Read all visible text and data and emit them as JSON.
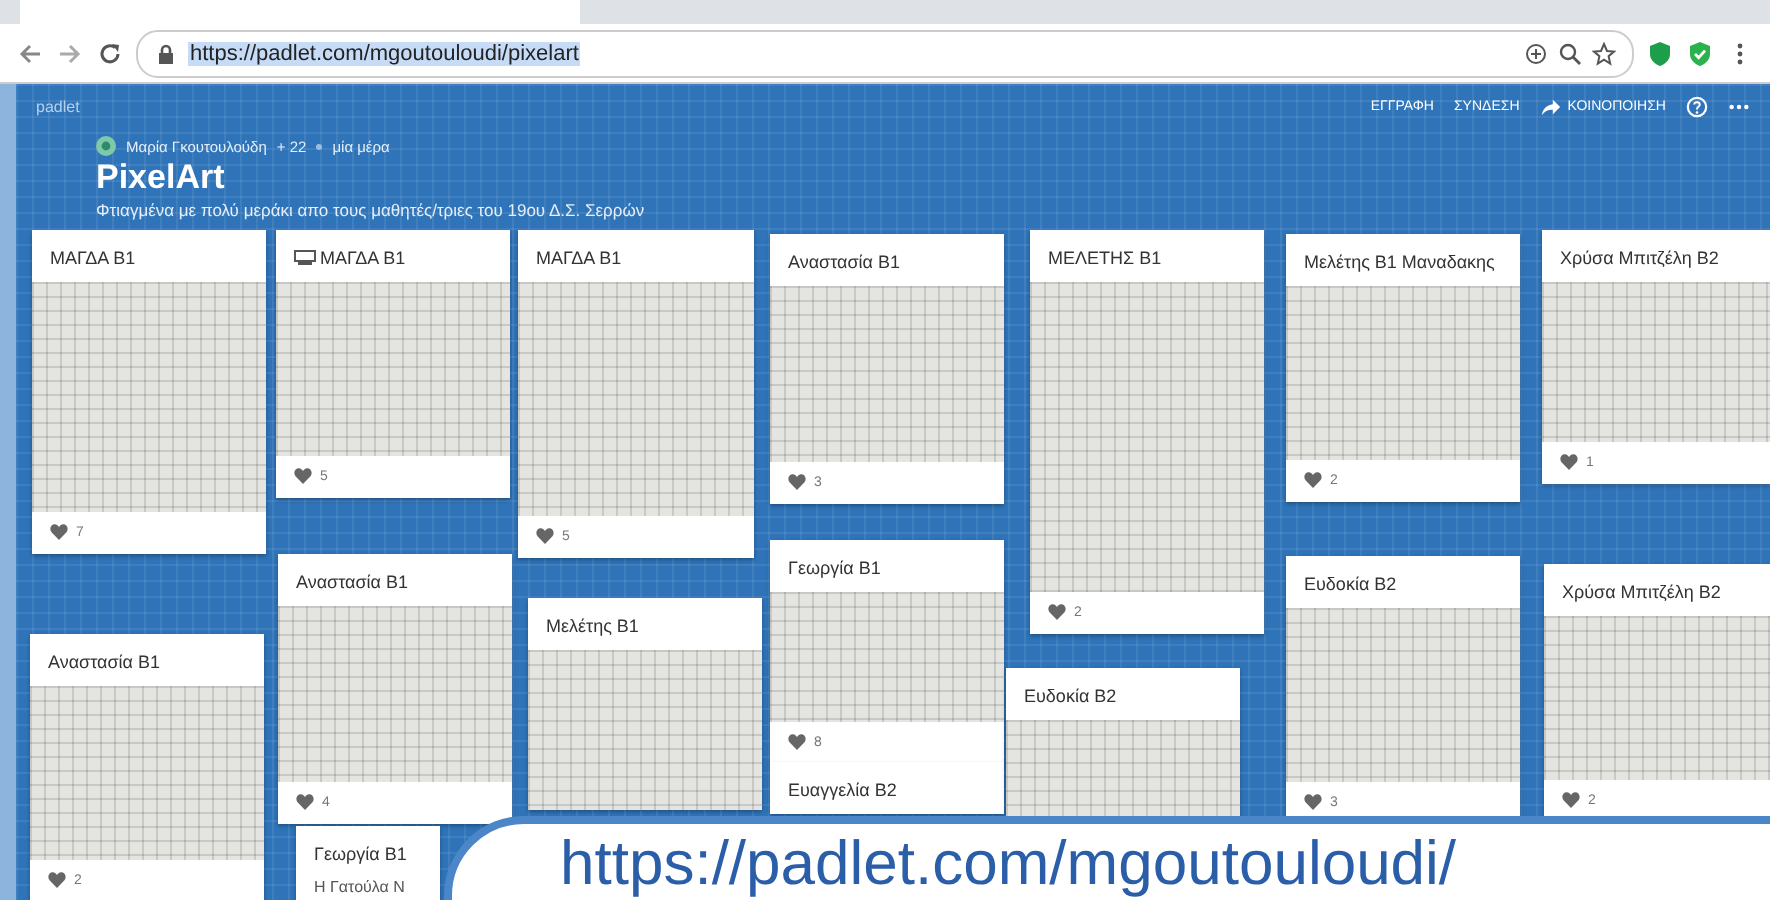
{
  "browser": {
    "url": "https://padlet.com/mgoutouloudi/pixelart"
  },
  "header": {
    "brand": "padlet",
    "actions": [
      {
        "kind": "link",
        "label": "ΕΓΓΡΑΦΗ"
      },
      {
        "kind": "link",
        "label": "ΣΥΝΔΕΣΗ"
      },
      {
        "kind": "share",
        "label": "ΚΟΙΝΟΠΟΙΗΣΗ"
      },
      {
        "kind": "help"
      },
      {
        "kind": "more"
      }
    ]
  },
  "board": {
    "author": "Μαρία Γκουτουλούδη",
    "contributors": "+ 22",
    "time": "μία μέρα",
    "title": "PixelArt",
    "description": "Φτιαγμένα με πολύ μεράκι απο τους μαθητές/τριες του 19ου Δ.Σ. Σερρών"
  },
  "posts": [
    {
      "title": "ΜΑΓΔΑ Β1",
      "title_icon": false,
      "likes": "7"
    },
    {
      "title": "ΜΑΓΔΑ Β1",
      "title_icon": true,
      "likes": "5"
    },
    {
      "title": "ΜΑΓΔΑ Β1",
      "title_icon": false,
      "likes": "5"
    },
    {
      "title": "Αναστασία Β1",
      "title_icon": false,
      "likes": "3"
    },
    {
      "title": "ΜΕΛΕΤΗΣ Β1",
      "title_icon": false,
      "likes": "2"
    },
    {
      "title": "Μελέτης Β1 Μαναδακης",
      "title_icon": false,
      "likes": "2"
    },
    {
      "title": "Χρύσα Μπιτζέλη Β2",
      "title_icon": false,
      "likes": "1"
    },
    {
      "title": "Αναστασία Β1",
      "title_icon": false,
      "likes": "2"
    },
    {
      "title": "Αναστασία Β1",
      "title_icon": false,
      "likes": "4"
    },
    {
      "title": "Μελέτης Β1",
      "title_icon": false
    },
    {
      "title": "Γεωργία Β1",
      "title_icon": false,
      "likes": "8"
    },
    {
      "title": "Ευαγγελία Β2",
      "title_icon": false
    },
    {
      "title": "Ευδοκία Β2",
      "title_icon": false
    },
    {
      "title": "Ευδοκία Β2",
      "title_icon": false,
      "likes": "3"
    },
    {
      "title": "Χρύσα Μπιτζέλη Β2",
      "title_icon": false,
      "likes": "2"
    },
    {
      "title": "Γεωργία Β1",
      "title_icon": false,
      "body": "Η Γατούλα Ν"
    }
  ],
  "callout": {
    "text": "https://padlet.com/mgoutouloudi/"
  }
}
